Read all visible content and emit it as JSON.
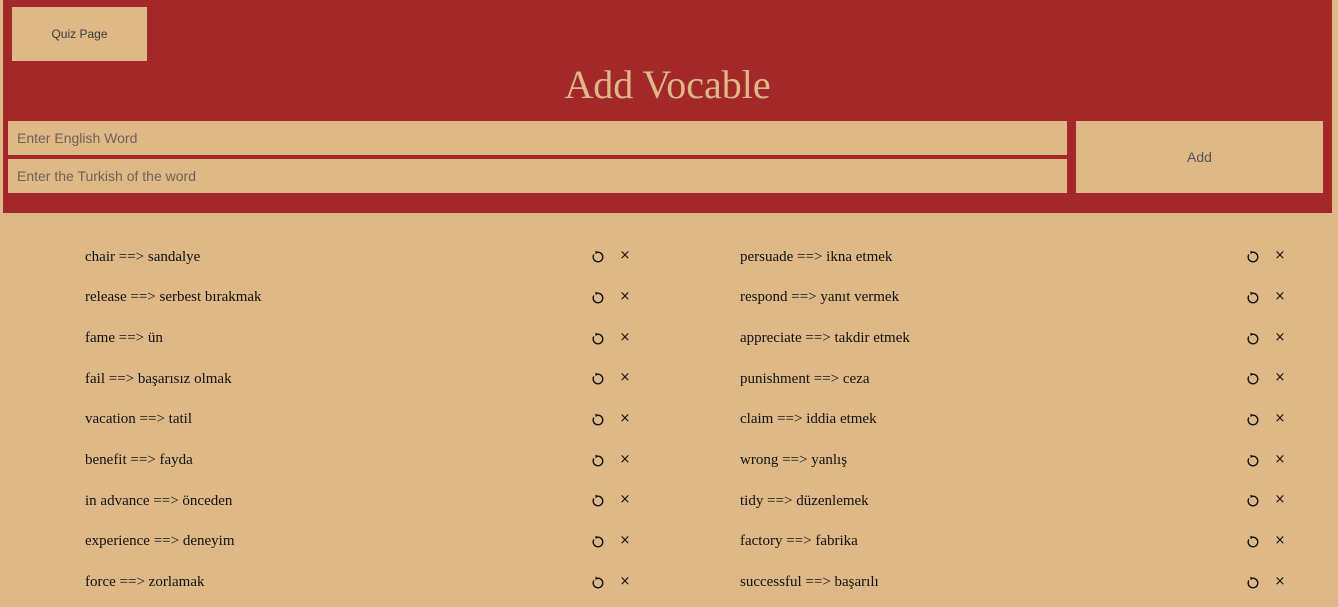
{
  "header": {
    "quiz_button": "Quiz Page",
    "title": "Add Vocable",
    "english_placeholder": "Enter English Word",
    "turkish_placeholder": "Enter the Turkish of the word",
    "english_value": "",
    "turkish_value": "",
    "add_button": "Add"
  },
  "vocab_left": [
    "chair ==> sandalye",
    "release ==> serbest bırakmak",
    "fame ==> ün",
    "fail ==> başarısız olmak",
    "vacation ==> tatil",
    "benefit ==> fayda",
    "in advance ==> önceden",
    "experience ==> deneyim",
    "force ==> zorlamak"
  ],
  "vocab_right": [
    "persuade ==> ikna etmek",
    "respond ==> yanıt vermek",
    "appreciate ==> takdir etmek",
    "punishment ==> ceza",
    "claim ==> iddia etmek",
    "wrong ==> yanlış",
    "tidy ==> düzenlemek",
    "factory ==> fabrika",
    "successful ==> başarılı"
  ],
  "icons": {
    "reload": "refresh-icon",
    "delete": "close-icon",
    "delete_glyph": "×"
  },
  "colors": {
    "background": "#deb887",
    "header": "#a3282a",
    "title": "#deb887"
  }
}
